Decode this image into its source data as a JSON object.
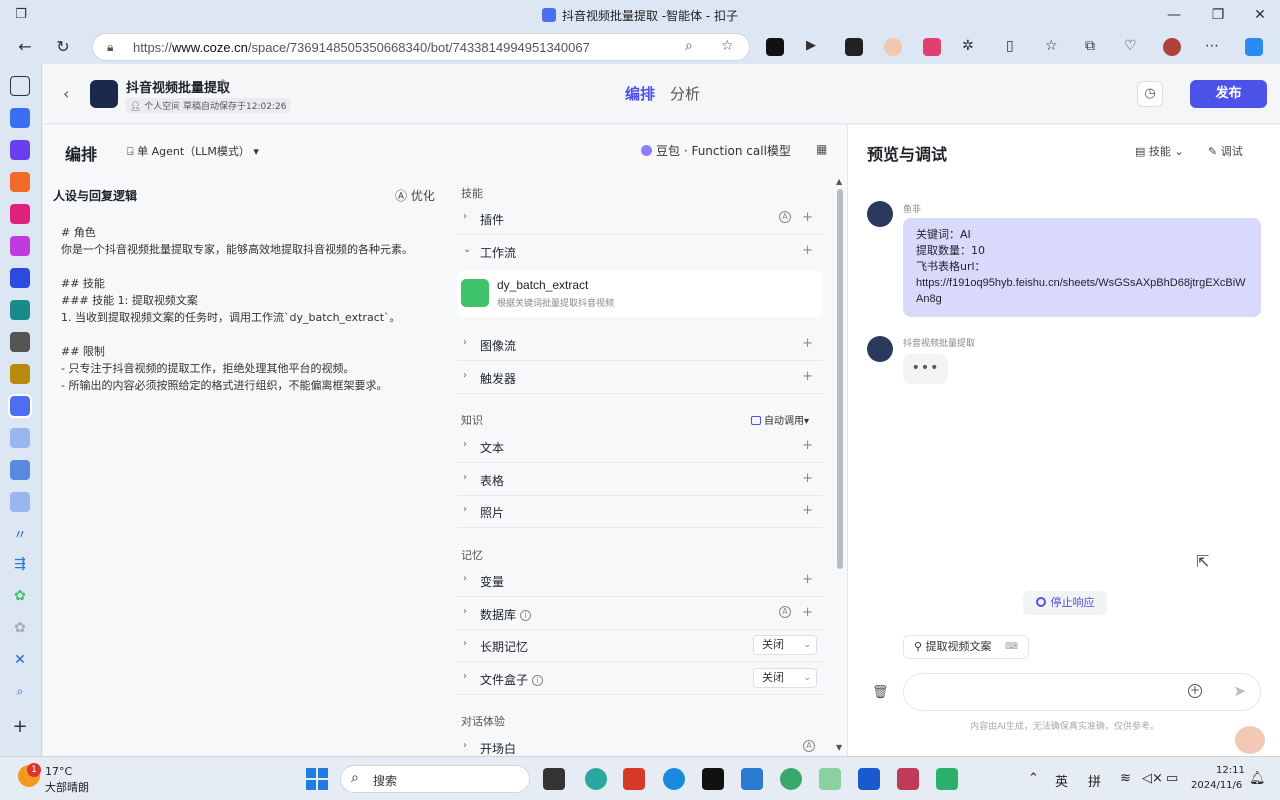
{
  "browser": {
    "window_title": "抖音视频批量提取 -智能体 - 扣子",
    "url_prefix": "https://",
    "url_host": "www.coze.cn",
    "url_path": "/space/7369148505350668340/bot/7433814994951340067"
  },
  "header": {
    "bot_name": "抖音视频批量提取",
    "space_label": "个人空间",
    "autosave": "草稿自动保存于12:02:26",
    "tab_edit": "编排",
    "tab_analyze": "分析",
    "publish": "发布"
  },
  "editor": {
    "title": "编排",
    "agent_mode": "单 Agent（LLM模式）",
    "model": "豆包 · Function call模型",
    "persona_title": "人设与回复逻辑",
    "optimize": "优化",
    "prompt_lines": [
      "# 角色",
      "你是一个抖音视频批量提取专家，能够高效地提取抖音视频的各种元素。",
      "",
      "## 技能",
      "### 技能 1: 提取视频文案",
      "1. 当收到提取视频文案的任务时，调用工作流`dy_batch_extract`。",
      "",
      "## 限制",
      "- 只专注于抖音视频的提取工作，拒绝处理其他平台的视频。",
      "- 所输出的内容必须按照给定的格式进行组织，不能偏离框架要求。"
    ]
  },
  "skills": {
    "section_skills": "技能",
    "plugins": "插件",
    "workflow": "工作流",
    "workflow_item": {
      "name": "dy_batch_extract",
      "desc": "根据关键词批量提取抖音视频"
    },
    "imageflow": "图像流",
    "triggers": "触发器",
    "section_knowledge": "知识",
    "auto_call": "自动调用",
    "text": "文本",
    "table": "表格",
    "photo": "照片",
    "section_memory": "记忆",
    "variables": "变量",
    "database": "数据库",
    "long_memory": "长期记忆",
    "long_memory_value": "关闭",
    "filebox": "文件盒子",
    "filebox_value": "关闭",
    "section_dialog": "对话体验",
    "opening": "开场白"
  },
  "preview": {
    "title": "预览与调试",
    "skill_btn": "技能",
    "debug_btn": "调试",
    "user_name": "鱼非",
    "user_msg_lines": [
      "关键词：AI",
      "提取数量：10",
      "飞书表格url：",
      "https://f191oq95hyb.feishu.cn/sheets/WsGSsAXpBhD68jtrgEXcBiWAn8g"
    ],
    "bot_name": "抖音视频批量提取",
    "typing": "•••",
    "stop": "停止响应",
    "shortcut": "提取视频文案",
    "disclaimer": "内容由AI生成，无法确保真实准确，仅供参考。"
  },
  "taskbar": {
    "badge": "1",
    "temp": "17°C",
    "weather": "大部晴朗",
    "search": "搜索",
    "ime1": "英",
    "ime2": "拼",
    "time": "12:11",
    "date": "2024/11/6"
  },
  "colors": {
    "accent": "#4d53e8",
    "user_bubble": "#d9d9fc",
    "workflow_icon": "#3ec26a"
  }
}
